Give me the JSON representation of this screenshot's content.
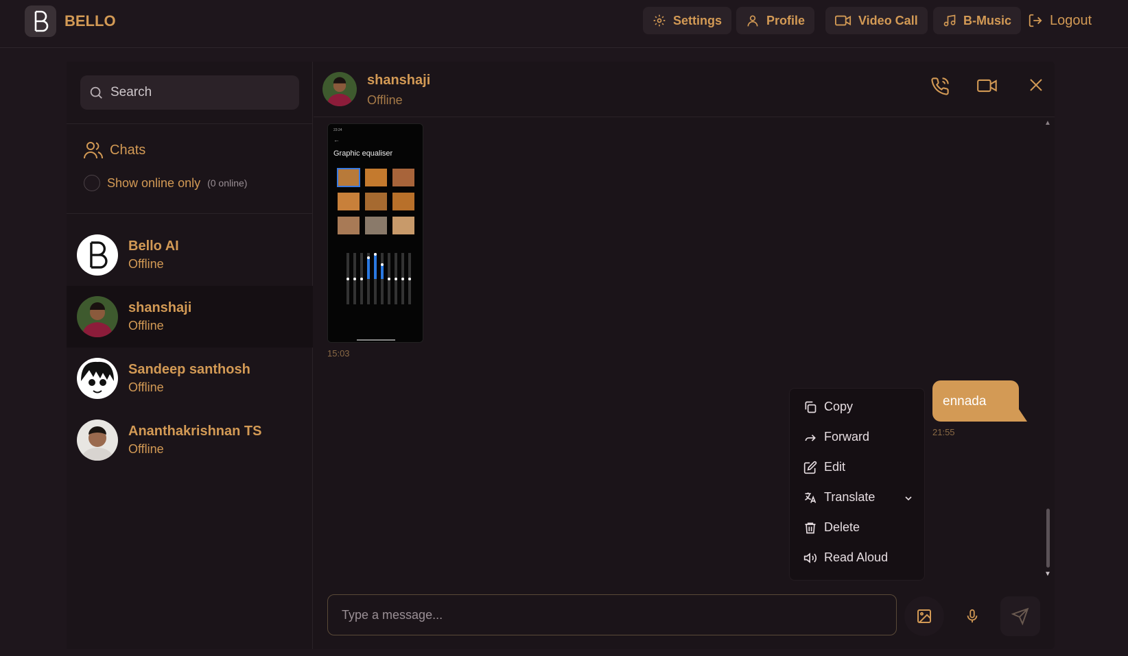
{
  "app": {
    "name": "BELLO"
  },
  "nav": {
    "settings": "Settings",
    "profile": "Profile",
    "video_call": "Video Call",
    "music": "B-Music",
    "logout": "Logout"
  },
  "sidebar": {
    "search_placeholder": "Search",
    "chats_heading": "Chats",
    "online_only_label": "Show online only",
    "online_count": "(0 online)",
    "contacts": [
      {
        "name": "Bello AI",
        "status": "Offline"
      },
      {
        "name": "shanshaji",
        "status": "Offline"
      },
      {
        "name": "Sandeep santhosh",
        "status": "Offline"
      },
      {
        "name": "Ananthakrishnan TS",
        "status": "Offline"
      }
    ]
  },
  "chat": {
    "contact_name": "shanshaji",
    "contact_status": "Offline",
    "messages": [
      {
        "type": "image",
        "time": "15:03",
        "image_title": "Graphic equaliser"
      },
      {
        "type": "text",
        "text": "ennada",
        "time": "21:55",
        "outgoing": true
      }
    ],
    "composer_placeholder": "Type a message..."
  },
  "context_menu": {
    "items": [
      "Copy",
      "Forward",
      "Edit",
      "Translate",
      "Delete",
      "Read Aloud"
    ]
  },
  "colors": {
    "accent": "#d39a55",
    "background": "#1e161c",
    "panel": "#1b1419"
  },
  "icons": [
    "bello-logo-icon",
    "gear-icon",
    "user-icon",
    "video-icon",
    "music-icon",
    "logout-icon",
    "search-icon",
    "users-icon",
    "phone-icon",
    "close-icon",
    "copy-icon",
    "forward-icon",
    "edit-icon",
    "translate-icon",
    "trash-icon",
    "speaker-icon",
    "image-icon",
    "mic-icon",
    "send-icon"
  ]
}
